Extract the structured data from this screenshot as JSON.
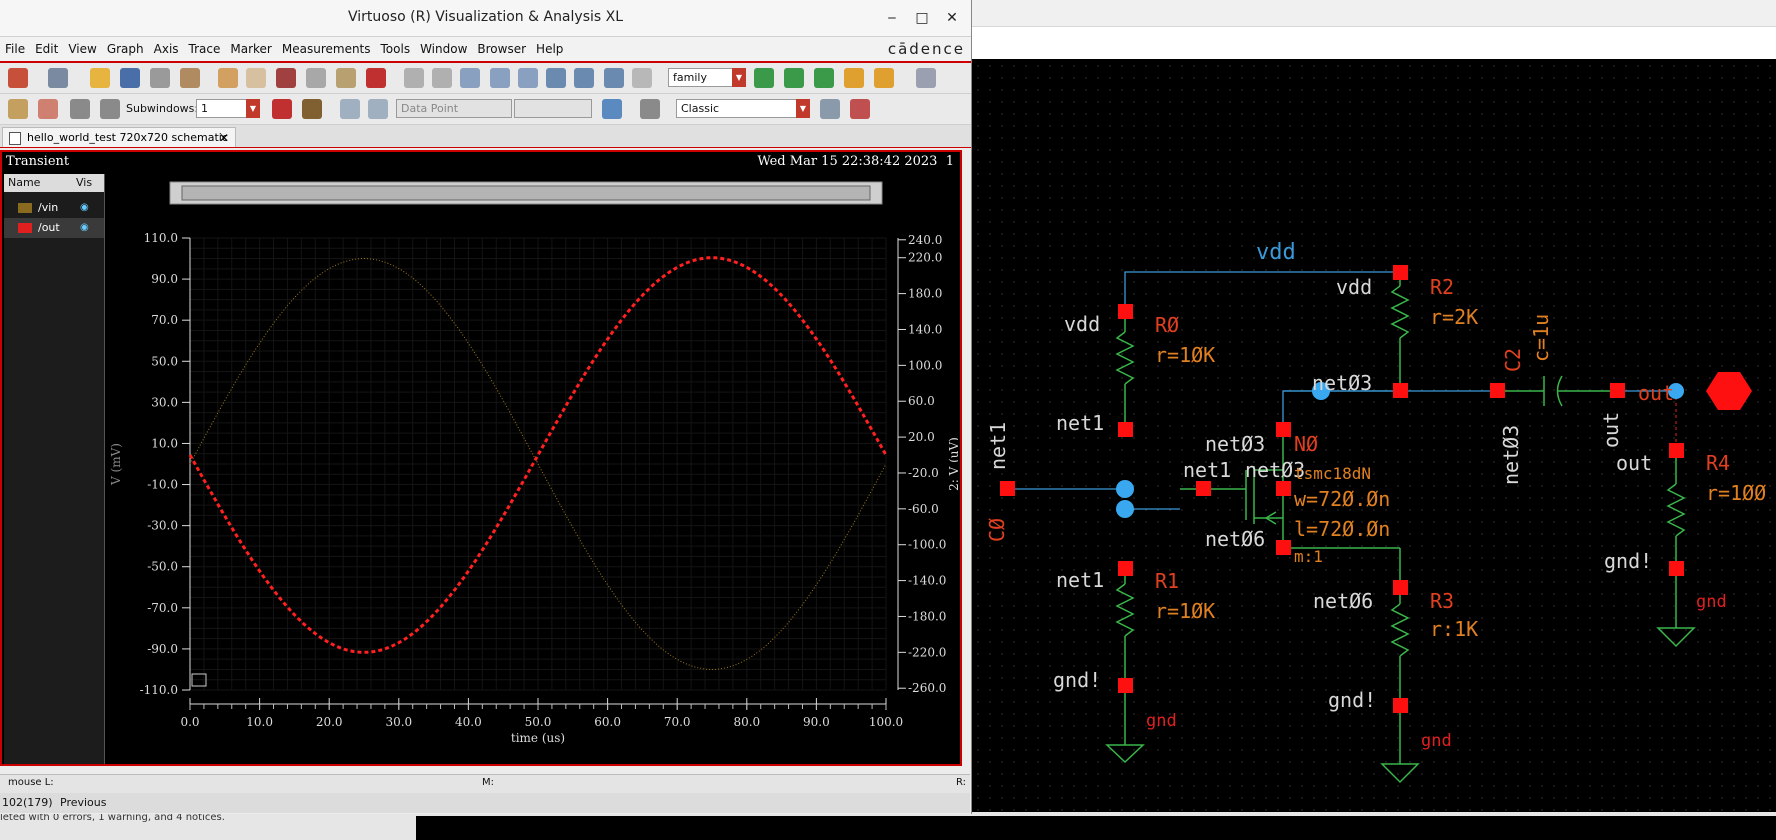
{
  "window": {
    "title": "Virtuoso (R) Visualization & Analysis XL",
    "minimize": "‒",
    "maximize": "□",
    "close": "✕",
    "logo": "cādence"
  },
  "menu": [
    "File",
    "Edit",
    "View",
    "Graph",
    "Axis",
    "Trace",
    "Marker",
    "Measurements",
    "Tools",
    "Window",
    "Browser",
    "Help"
  ],
  "toolbar": {
    "family_combo": "family",
    "subwindows_label": "Subwindows:",
    "subwindows_value": "1",
    "marker_combo": "Data Point",
    "style_combo": "Classic"
  },
  "tab": {
    "label": "hello_world_test 720x720 schematic",
    "close": "✕"
  },
  "plot": {
    "title": "Transient",
    "date": "Wed Mar 15 22:38:42 2023",
    "subwin": "1",
    "legend_header": [
      "Name",
      "Vis"
    ],
    "legend": [
      {
        "name": "/vin",
        "color": "#8a6a1e",
        "eye": "◉"
      },
      {
        "name": "/out",
        "color": "#e0201e",
        "eye": "◉"
      }
    ]
  },
  "chart_data": {
    "type": "line",
    "xlabel": "time (us)",
    "ylabel_left": "V (mV)",
    "ylabel_right": "2: V (uV)",
    "x_ticks": [
      "0.0",
      "10.0",
      "20.0",
      "30.0",
      "40.0",
      "50.0",
      "60.0",
      "70.0",
      "80.0",
      "90.0",
      "100.0"
    ],
    "y_left_ticks": [
      "110.0",
      "90.0",
      "70.0",
      "50.0",
      "30.0",
      "10.0",
      "-10.0",
      "-30.0",
      "-50.0",
      "-70.0",
      "-90.0",
      "-110.0"
    ],
    "y_right_ticks": [
      "240.0",
      "220.0",
      "180.0",
      "140.0",
      "100.0",
      "60.0",
      "20.0",
      "-20.0",
      "-60.0",
      "-100.0",
      "-140.0",
      "-180.0",
      "-220.0",
      "-260.0"
    ],
    "xlim": [
      0,
      100
    ],
    "ylim_left": [
      -110,
      110
    ],
    "ylim_right": [
      -262,
      242
    ],
    "series": [
      {
        "name": "/vin",
        "axis": "left",
        "color": "#a07a1c",
        "style": "solid",
        "amplitude": 100,
        "phase": "sin"
      },
      {
        "name": "/out",
        "axis": "right",
        "color": "#ff2020",
        "style": "dashed",
        "amplitude": 220,
        "phase": "-sin"
      }
    ]
  },
  "status": {
    "mouse_l": "mouse L:",
    "m": "M:",
    "r": "R:",
    "counter": "102(179)",
    "previous": "Previous",
    "log": "leted with 0 errors, 1 warning, and 4 notices."
  },
  "schematic": {
    "labels": {
      "vdd_top": "vdd",
      "vdd_r0": "vdd",
      "r0": "RØ",
      "r0_val": "r=1ØK",
      "net1_a": "net1",
      "net1_b": "net1",
      "net1_c": "net1",
      "net1_vert": "net1",
      "r1": "R1",
      "r1_val": "r=1ØK",
      "gnd1": "gnd!",
      "gnd1_lbl": "gnd",
      "vdd_r2": "vdd",
      "r2": "R2",
      "r2_val": "r=2K",
      "net03_a": "netØ3",
      "net03_b": "netØ3",
      "net03_c": "netØ3",
      "net03_vert": "netØ3",
      "n0": "NØ",
      "model": "tsmc18dN",
      "w": "w=72Ø.Øn",
      "l": "l=72Ø.Øn",
      "m": "m:1",
      "net06_a": "netØ6",
      "net06_b": "netØ6",
      "r3": "R3",
      "r3_val": "r:1K",
      "gnd3": "gnd!",
      "gnd3_lbl": "gnd",
      "c2": "C2",
      "c2_val": "c=1u",
      "out_vert": "out",
      "out_pin": "out",
      "out_r4": "out",
      "r4": "R4",
      "r4_val": "r=1ØØ",
      "gnd4": "gnd!",
      "gnd4_lbl": "gnd",
      "c0": "CØ"
    }
  }
}
